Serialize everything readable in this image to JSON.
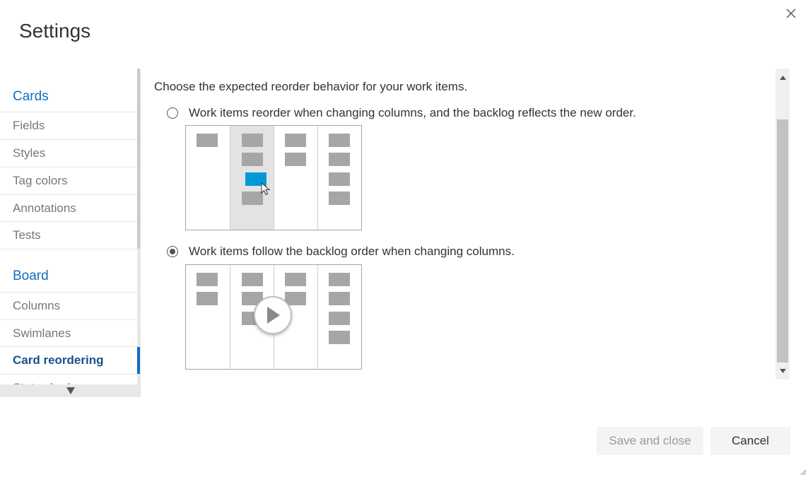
{
  "dialog": {
    "title": "Settings",
    "close_icon": "close-icon"
  },
  "nav": {
    "groups": [
      {
        "label": "Cards",
        "items": [
          "Fields",
          "Styles",
          "Tag colors",
          "Annotations",
          "Tests"
        ]
      },
      {
        "label": "Board",
        "items": [
          "Columns",
          "Swimlanes",
          "Card reordering",
          "Status badge"
        ]
      }
    ],
    "selected": "Card reordering",
    "scroll_down_icon": "triangle-down-icon"
  },
  "content": {
    "intro": "Choose the expected reorder behavior for your work items.",
    "options": [
      {
        "label": "Work items reorder when changing columns, and the backlog reflects the new order.",
        "checked": false,
        "diagram": "reorder-diagram"
      },
      {
        "label": "Work items follow the backlog order when changing columns.",
        "checked": true,
        "diagram": "backlog-order-diagram"
      }
    ],
    "play_icon": "play-icon",
    "cursor_icon": "mouse-pointer-icon",
    "highlight_color": "#0099d4"
  },
  "buttons": {
    "save": "Save and close",
    "save_disabled": true,
    "cancel": "Cancel"
  }
}
